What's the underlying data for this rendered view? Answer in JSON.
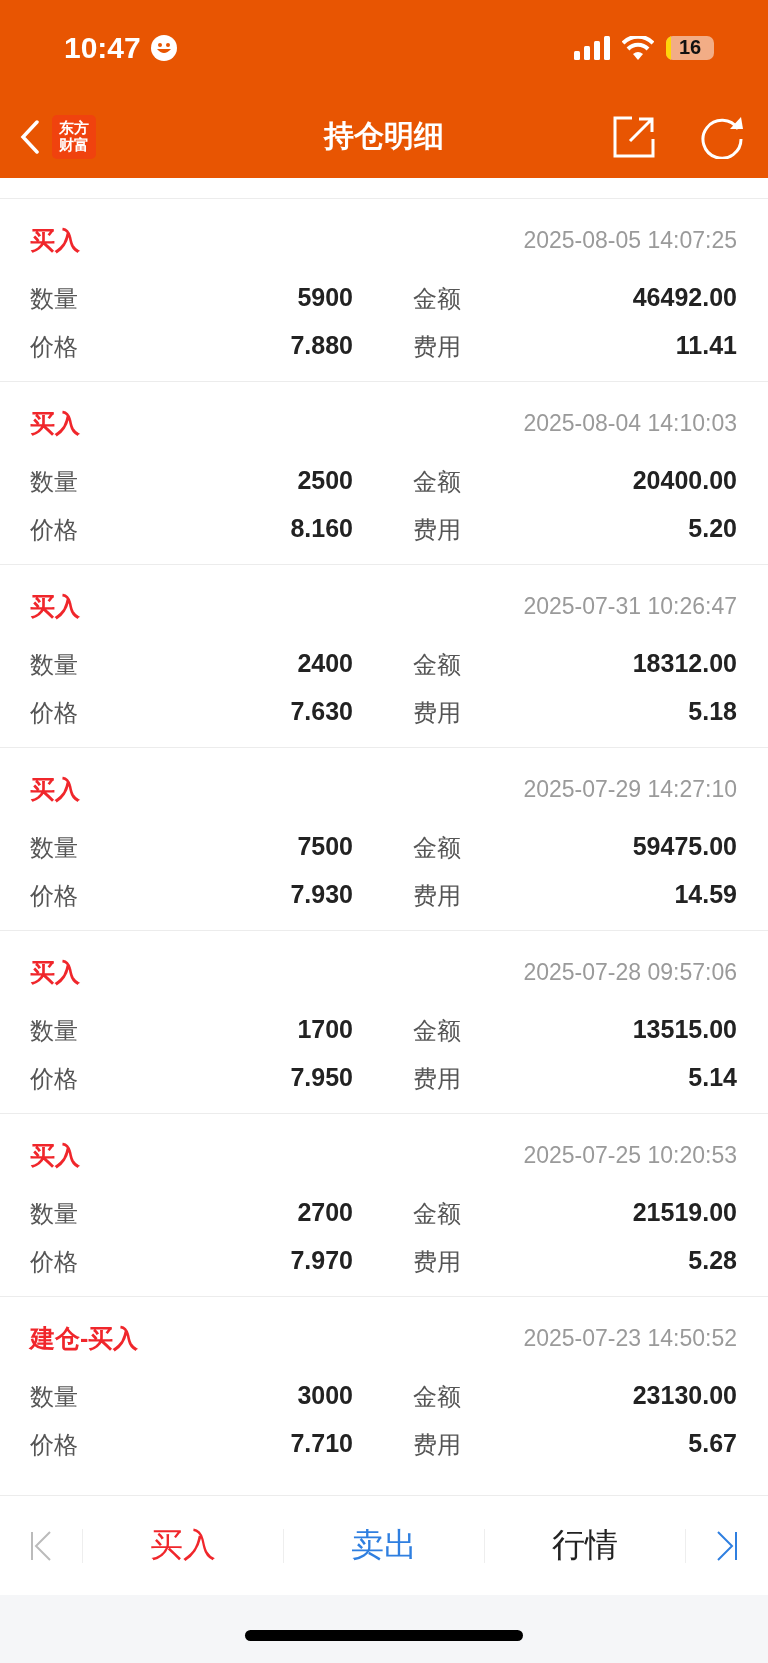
{
  "status_bar": {
    "time": "10:47",
    "battery": "16"
  },
  "nav_bar": {
    "logo": [
      "东方",
      "财富"
    ],
    "title": "持仓明细"
  },
  "records": [
    {
      "type": "买入",
      "datetime": "2025-08-05 14:07:25",
      "fields": [
        [
          "数量",
          "5900",
          "金额",
          "46492.00"
        ],
        [
          "价格",
          "7.880",
          "费用",
          "11.41"
        ]
      ]
    },
    {
      "type": "买入",
      "datetime": "2025-08-04 14:10:03",
      "fields": [
        [
          "数量",
          "2500",
          "金额",
          "20400.00"
        ],
        [
          "价格",
          "8.160",
          "费用",
          "5.20"
        ]
      ]
    },
    {
      "type": "买入",
      "datetime": "2025-07-31 10:26:47",
      "fields": [
        [
          "数量",
          "2400",
          "金额",
          "18312.00"
        ],
        [
          "价格",
          "7.630",
          "费用",
          "5.18"
        ]
      ]
    },
    {
      "type": "买入",
      "datetime": "2025-07-29 14:27:10",
      "fields": [
        [
          "数量",
          "7500",
          "金额",
          "59475.00"
        ],
        [
          "价格",
          "7.930",
          "费用",
          "14.59"
        ]
      ]
    },
    {
      "type": "买入",
      "datetime": "2025-07-28 09:57:06",
      "fields": [
        [
          "数量",
          "1700",
          "金额",
          "13515.00"
        ],
        [
          "价格",
          "7.950",
          "费用",
          "5.14"
        ]
      ]
    },
    {
      "type": "买入",
      "datetime": "2025-07-25 10:20:53",
      "fields": [
        [
          "数量",
          "2700",
          "金额",
          "21519.00"
        ],
        [
          "价格",
          "7.970",
          "费用",
          "5.28"
        ]
      ]
    },
    {
      "type": "建仓-买入",
      "datetime": "2025-07-23 14:50:52",
      "fields": [
        [
          "数量",
          "3000",
          "金额",
          "23130.00"
        ],
        [
          "价格",
          "7.710",
          "费用",
          "5.67"
        ]
      ]
    }
  ],
  "toolbar": {
    "first_disabled": true,
    "last_disabled": false,
    "buttons": [
      {
        "label": "买入",
        "color": "#f0262b"
      },
      {
        "label": "卖出",
        "color": "#2f7fe0"
      },
      {
        "label": "行情",
        "color": "#222222"
      }
    ]
  }
}
